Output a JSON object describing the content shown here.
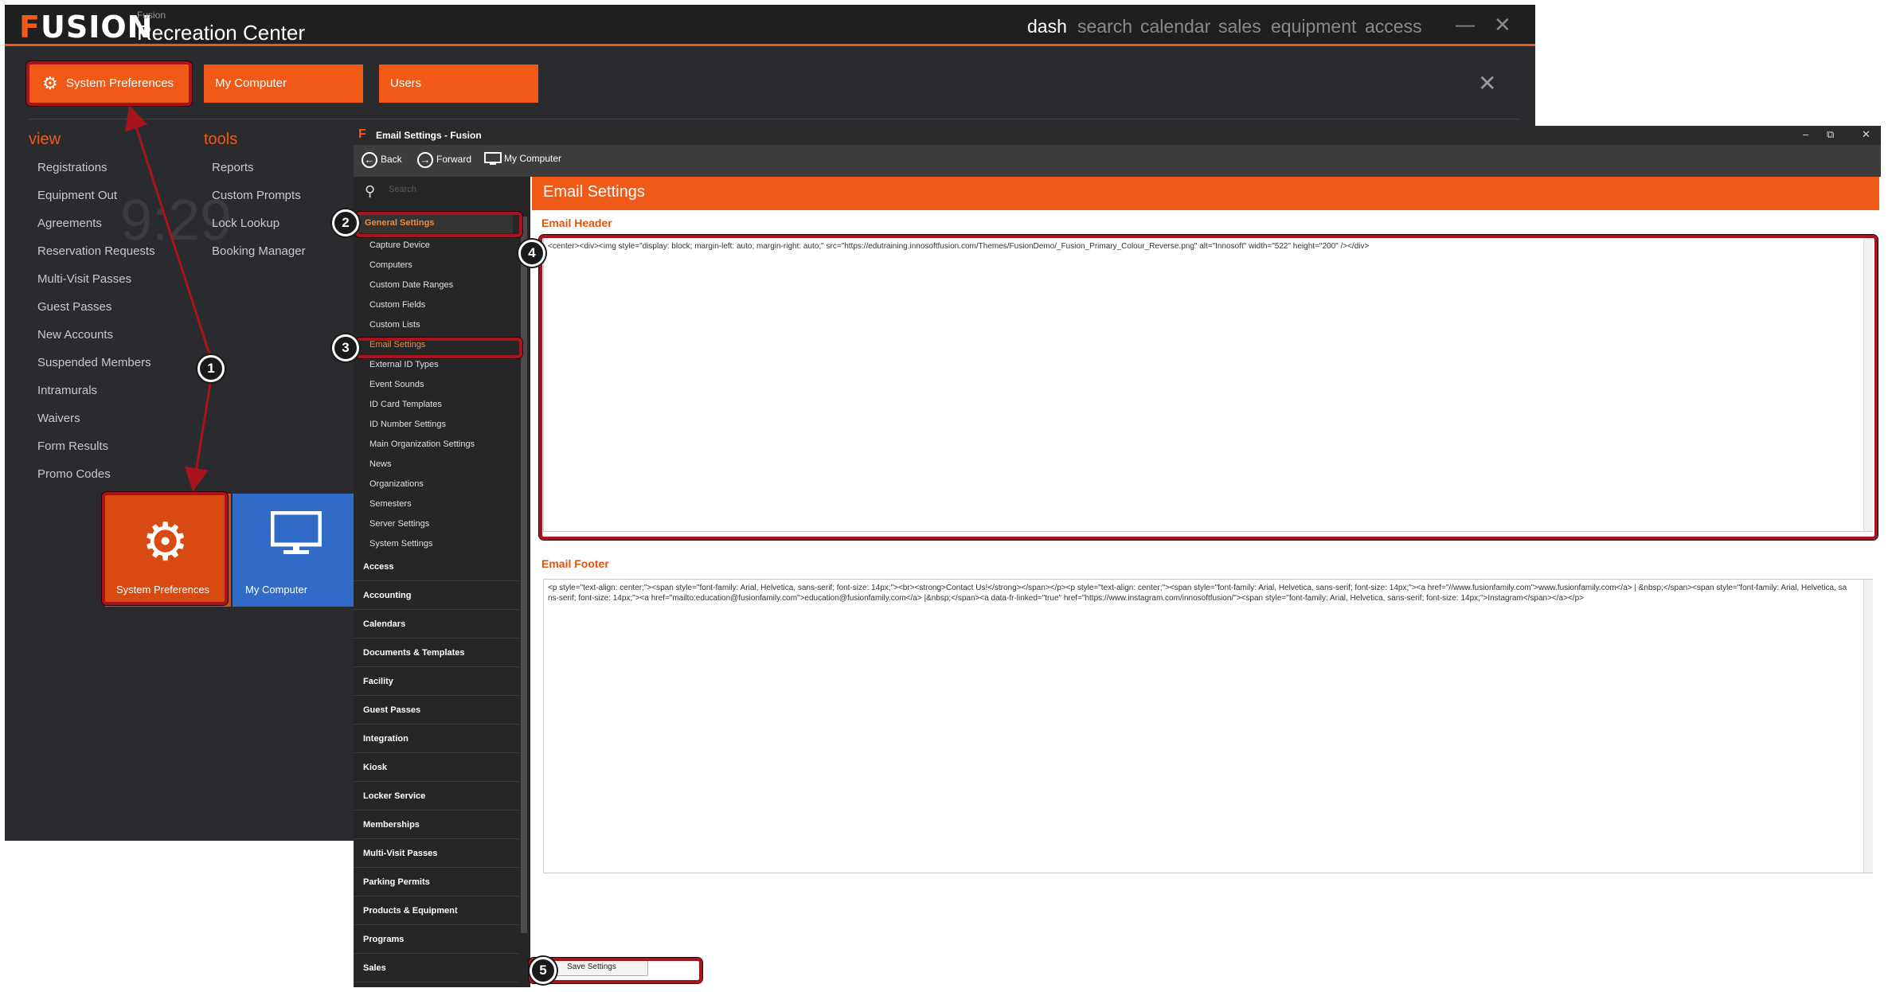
{
  "app": {
    "logo": "FUSION",
    "subtitle": "Fusion",
    "title": "Recreation Center",
    "nav": [
      "dash",
      "search",
      "calendar",
      "sales",
      "equipment",
      "access"
    ]
  },
  "quickbar": {
    "system_preferences": "System Preferences",
    "my_computer": "My Computer",
    "users": "Users"
  },
  "view": {
    "heading": "view",
    "items": [
      "Registrations",
      "Equipment Out",
      "Agreements",
      "Reservation Requests",
      "Multi-Visit Passes",
      "Guest Passes",
      "New Accounts",
      "Suspended Members",
      "Intramurals",
      "Waivers",
      "Form Results",
      "Promo Codes"
    ]
  },
  "tools": {
    "heading": "tools",
    "items": [
      "Reports",
      "Custom Prompts",
      "Lock Lookup",
      "Booking Manager"
    ]
  },
  "tiles": {
    "system_preferences": "System Preferences",
    "my_computer": "My Computer"
  },
  "settings_window": {
    "title": "Email Settings - Fusion",
    "back": "Back",
    "forward": "Forward",
    "my_computer": "My Computer",
    "search_placeholder": "Search",
    "general_settings": "General Settings",
    "general_items": [
      "Capture Device",
      "Computers",
      "Custom Date Ranges",
      "Custom Fields",
      "Custom Lists",
      "Email Settings",
      "External ID Types",
      "Event Sounds",
      "ID Card Templates",
      "ID Number Settings",
      "Main Organization Settings",
      "News",
      "Organizations",
      "Semesters",
      "Server Settings",
      "System Settings"
    ],
    "categories": [
      "Access",
      "Accounting",
      "Calendars",
      "Documents & Templates",
      "Facility",
      "Guest Passes",
      "Integration",
      "Kiosk",
      "Locker Service",
      "Memberships",
      "Multi-Visit Passes",
      "Parking Permits",
      "Products & Equipment",
      "Programs",
      "Sales"
    ],
    "heading": "Email Settings",
    "header_label": "Email Header",
    "header_value": "<center><div><img style=\"display: block; margin-left: auto; margin-right: auto;\" src=\"https://edutraining.innosoftfusion.com/Themes/FusionDemo/_Fusion_Primary_Colour_Reverse.png\" alt=\"Innosoft\" width=\"522\" height=\"200\" /></div>",
    "footer_label": "Email Footer",
    "footer_value": "<p style=\"text-align: center;\"><span style=\"font-family: Arial, Helvetica, sans-serif; font-size: 14px;\"><br><strong>Contact Us!</strong></span></p><p style=\"text-align: center;\"><span style=\"font-family: Arial, Helvetica, sans-serif; font-size: 14px;\"><a href=\"//www.fusionfamily.com\">www.fusionfamily.com</a> | &nbsp;</span><span style=\"font-family: Arial, Helvetica, sans-serif; font-size: 14px;\"><a href=\"mailto:education@fusionfamily.com\">education@fusionfamily.com</a> |&nbsp;</span><a data-fr-linked=\"true\" href=\"https://www.instagram.com/innosoftfusion/\"><span style=\"font-family: Arial, Helvetica, sans-serif; font-size: 14px;\">Instagram</span></a></p>",
    "save_button": "Save Settings"
  },
  "callouts": [
    "1",
    "2",
    "3",
    "4",
    "5"
  ],
  "colors": {
    "accent": "#f05a16",
    "highlight": "#a8131c",
    "tile_blue": "#2f6bc7"
  }
}
